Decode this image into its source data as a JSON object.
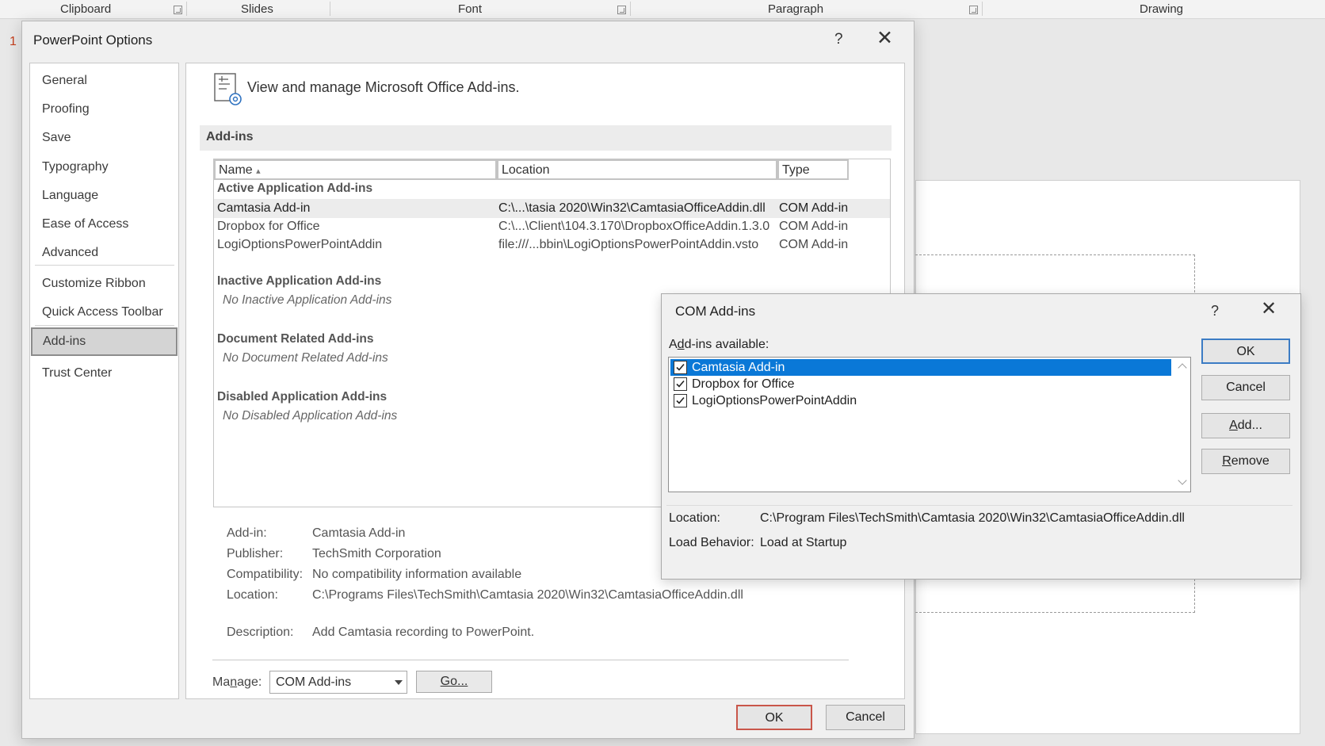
{
  "ribbon": {
    "groups": [
      "Clipboard",
      "Slides",
      "Font",
      "Paragraph",
      "Drawing"
    ]
  },
  "slide_number": "1",
  "options_dialog": {
    "title": "PowerPoint Options",
    "help": "?",
    "close": "✕",
    "nav_items": [
      "General",
      "Proofing",
      "Save",
      "Typography",
      "Language",
      "Ease of Access",
      "Advanced",
      "Customize Ribbon",
      "Quick Access Toolbar",
      "Add-ins",
      "Trust Center"
    ],
    "selected_nav": "Add-ins",
    "header_text": "View and manage Microsoft Office Add-ins.",
    "section_title": "Add-ins",
    "columns": {
      "name": "Name",
      "sort_indicator": "▴",
      "location": "Location",
      "type": "Type"
    },
    "groups": {
      "active": {
        "title": "Active Application Add-ins",
        "rows": [
          {
            "name": "Camtasia Add-in",
            "location": "C:\\...\\tasia 2020\\Win32\\CamtasiaOfficeAddin.dll",
            "type": "COM Add-in"
          },
          {
            "name": "Dropbox for Office",
            "location": "C:\\...\\Client\\104.3.170\\DropboxOfficeAddin.1.3.0",
            "type": "COM Add-in"
          },
          {
            "name": "LogiOptionsPowerPointAddin",
            "location": "file:///...bbin\\LogiOptionsPowerPointAddin.vsto",
            "type": "COM Add-in"
          }
        ]
      },
      "inactive": {
        "title": "Inactive Application Add-ins",
        "empty": "No Inactive Application Add-ins"
      },
      "document": {
        "title": "Document Related Add-ins",
        "empty": "No Document Related Add-ins"
      },
      "disabled": {
        "title": "Disabled Application Add-ins",
        "empty": "No Disabled Application Add-ins"
      }
    },
    "details": {
      "addin_label": "Add-in:",
      "addin_value": "Camtasia Add-in",
      "publisher_label": "Publisher:",
      "publisher_value": "TechSmith Corporation",
      "compat_label": "Compatibility:",
      "compat_value": "No compatibility information available",
      "location_label": "Location:",
      "location_value": "C:\\Programs Files\\TechSmith\\Camtasia 2020\\Win32\\CamtasiaOfficeAddin.dll",
      "desc_label": "Description:",
      "desc_value": "Add Camtasia recording to PowerPoint."
    },
    "manage": {
      "label_pre": "Ma",
      "label_u": "n",
      "label_post": "age:",
      "selected": "COM Add-ins",
      "go_u": "G",
      "go_post": "o..."
    },
    "ok": "OK",
    "cancel": "Cancel"
  },
  "com_dialog": {
    "title": "COM Add-ins",
    "help": "?",
    "close": "✕",
    "available_pre": "A",
    "available_u": "d",
    "available_post": "d-ins available:",
    "items": [
      {
        "label": "Camtasia Add-in",
        "checked": true
      },
      {
        "label": "Dropbox for Office",
        "checked": true
      },
      {
        "label": "LogiOptionsPowerPointAddin",
        "checked": true
      }
    ],
    "ok": "OK",
    "cancel": "Cancel",
    "add_u": "A",
    "add_post": "dd...",
    "remove_u": "R",
    "remove_post": "emove",
    "location_label": "Location:",
    "location_value": "C:\\Program Files\\TechSmith\\Camtasia 2020\\Win32\\CamtasiaOfficeAddin.dll",
    "load_label": "Load Behavior:",
    "load_value": "Load at Startup"
  },
  "colors": {
    "selection": "#0a78d7",
    "ok_border": "#c9564a",
    "default_border": "#3c7cc4"
  }
}
